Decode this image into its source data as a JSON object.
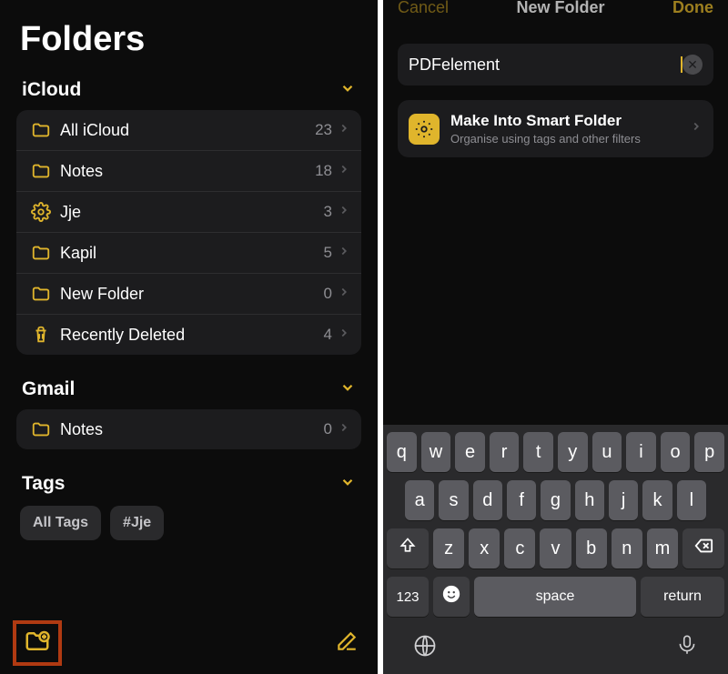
{
  "left": {
    "title": "Folders",
    "sections": [
      {
        "header": "iCloud",
        "rows": [
          {
            "name": "All iCloud",
            "count": "23",
            "icon": "folder"
          },
          {
            "name": "Notes",
            "count": "18",
            "icon": "folder"
          },
          {
            "name": "Jje",
            "count": "3",
            "icon": "gear"
          },
          {
            "name": "Kapil",
            "count": "5",
            "icon": "folder"
          },
          {
            "name": "New Folder",
            "count": "0",
            "icon": "folder"
          },
          {
            "name": "Recently Deleted",
            "count": "4",
            "icon": "trash"
          }
        ]
      },
      {
        "header": "Gmail",
        "rows": [
          {
            "name": "Notes",
            "count": "0",
            "icon": "folder"
          }
        ]
      }
    ],
    "tags_header": "Tags",
    "tags": [
      "All Tags",
      "#Jje"
    ]
  },
  "right": {
    "nav": {
      "cancel": "Cancel",
      "title": "New Folder",
      "done": "Done"
    },
    "input_value": "PDFelement",
    "smart": {
      "title": "Make Into Smart Folder",
      "subtitle": "Organise using tags and other filters"
    },
    "keyboard": {
      "row1": [
        "q",
        "w",
        "e",
        "r",
        "t",
        "y",
        "u",
        "i",
        "o",
        "p"
      ],
      "row2": [
        "a",
        "s",
        "d",
        "f",
        "g",
        "h",
        "j",
        "k",
        "l"
      ],
      "row3": [
        "z",
        "x",
        "c",
        "v",
        "b",
        "n",
        "m"
      ],
      "num": "123",
      "space": "space",
      "return": "return"
    }
  }
}
